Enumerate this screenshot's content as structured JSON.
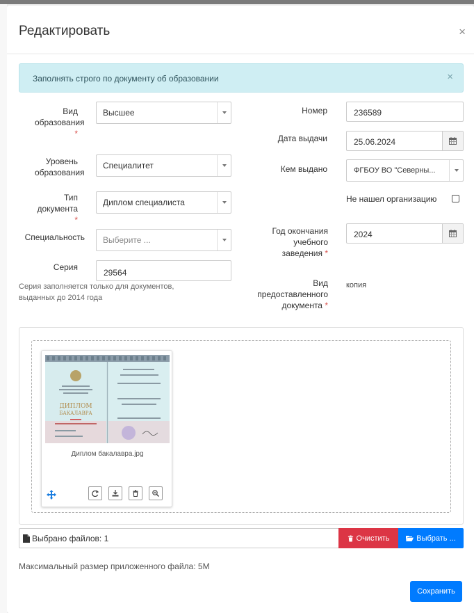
{
  "modal": {
    "title": "Редактировать",
    "close": "×"
  },
  "alert": {
    "text": "Заполнять строго по документу об образовании",
    "close": "×"
  },
  "form": {
    "education_type": {
      "label_line1": "Вид",
      "label_line2": "образования",
      "required": "*",
      "value": "Высшее"
    },
    "education_level": {
      "label_line1": "Уровень",
      "label_line2": "образования",
      "value": "Специалитет"
    },
    "document_type": {
      "label_line1": "Тип",
      "label_line2": "документа",
      "required": "*",
      "value": "Диплом специалиста"
    },
    "specialty": {
      "label": "Специальность",
      "placeholder": "Выберите ..."
    },
    "series": {
      "label": "Серия",
      "value": "29564",
      "hint_line1": "Серия заполняется только для документов,",
      "hint_line2": "выданных до 2014 года"
    },
    "number": {
      "label": "Номер",
      "value": "236589"
    },
    "issue_date": {
      "label": "Дата выдачи",
      "value": "25.06.2024"
    },
    "issued_by": {
      "label": "Кем выдано",
      "value": "ФГБОУ ВО \"Северны..."
    },
    "org_not_found": {
      "label": "Не нашел организацию",
      "checked": false
    },
    "graduation_year": {
      "label_line1": "Год окончания",
      "label_line2": "учебного",
      "label_line3": "заведения",
      "required": "*",
      "value": "2024"
    },
    "provided_doc": {
      "label_line1": "Вид",
      "label_line2": "предоставленного",
      "label_line3": "документа",
      "required": "*",
      "value": "копия"
    }
  },
  "upload": {
    "file_name": "Диплом бакалавра.jpg",
    "selected_caption": "Выбрано файлов: 1",
    "clear_label": "Очистить",
    "browse_label": "Выбрать ...",
    "max_size_text": "Максимальный размер приложенного файла: 5M",
    "diploma_word": "ДИПЛОМ",
    "diploma_sub": "БАКАЛАВРА"
  },
  "footer": {
    "save_label": "Сохранить"
  },
  "colors": {
    "primary": "#007bff",
    "danger": "#dc3545",
    "alert_bg": "#cfeef3",
    "required": "#d9534f"
  }
}
